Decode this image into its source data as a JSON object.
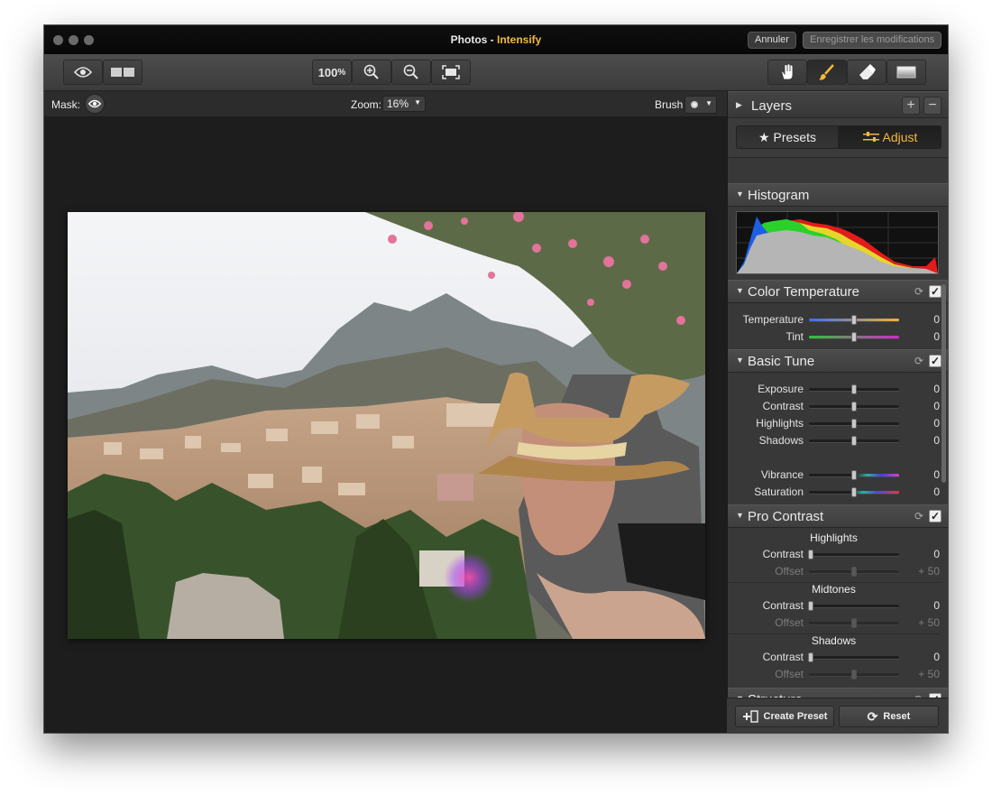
{
  "titlebar": {
    "app": "Photos",
    "separator": " - ",
    "extension": "Intensify",
    "cancel_label": "Annuler",
    "save_label": "Enregistrer les modifications"
  },
  "toolbar": {
    "zoom_100_label": "100",
    "zoom_unit": "%"
  },
  "optionsbar": {
    "mask_label": "Mask:",
    "zoom_label": "Zoom:",
    "zoom_value": "16%",
    "brush_label": "Brush"
  },
  "panel": {
    "layers_label": "Layers",
    "tabs": [
      {
        "label": "Presets",
        "icon": "star-icon"
      },
      {
        "label": "Adjust",
        "icon": "sliders-icon"
      }
    ],
    "histogram_label": "Histogram",
    "color_temperature": {
      "label": "Color Temperature",
      "rows": [
        {
          "label": "Temperature",
          "value": "0"
        },
        {
          "label": "Tint",
          "value": "0"
        }
      ]
    },
    "basic_tune": {
      "label": "Basic Tune",
      "rows": [
        {
          "label": "Exposure",
          "value": "0"
        },
        {
          "label": "Contrast",
          "value": "0"
        },
        {
          "label": "Highlights",
          "value": "0"
        },
        {
          "label": "Shadows",
          "value": "0"
        },
        {
          "label": "Vibrance",
          "value": "0"
        },
        {
          "label": "Saturation",
          "value": "0"
        }
      ]
    },
    "pro_contrast": {
      "label": "Pro Contrast",
      "groups": [
        {
          "title": "Highlights",
          "contrast_label": "Contrast",
          "contrast_value": "0",
          "offset_label": "Offset",
          "offset_value": "+ 50"
        },
        {
          "title": "Midtones",
          "contrast_label": "Contrast",
          "contrast_value": "0",
          "offset_label": "Offset",
          "offset_value": "+ 50"
        },
        {
          "title": "Shadows",
          "contrast_label": "Contrast",
          "contrast_value": "0",
          "offset_label": "Offset",
          "offset_value": "+ 50"
        }
      ]
    },
    "structure_label": "Structure",
    "create_preset_label": "Create Preset",
    "reset_label": "Reset"
  },
  "colors": {
    "accent": "#f5b83b",
    "panel_bg": "#383838",
    "canvas_bg": "#1d1d1d"
  }
}
